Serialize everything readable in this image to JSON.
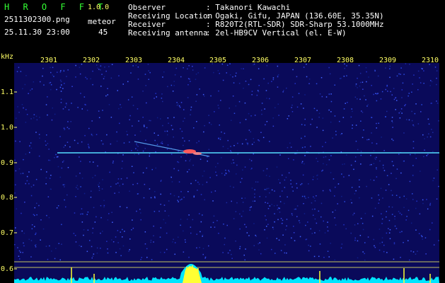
{
  "app": {
    "name": "H R O F F T",
    "version": "1.0.0"
  },
  "file": {
    "name": "2511302300.png",
    "datetime": "25.11.30 23:00"
  },
  "counter": {
    "label": "meteor",
    "value": "45"
  },
  "info": [
    {
      "label": "Observer",
      "value": ": Takanori Kawachi"
    },
    {
      "label": "Receiving Location",
      "value": ": Ogaki, Gifu, JAPAN (136.60E, 35.35N)"
    },
    {
      "label": "Receiver",
      "value": ": R820T2(RTL-SDR) SDR-Sharp 53.1000MHz"
    },
    {
      "label": "Receiving antenna",
      "value": ": 2el-HB9CV Vertical (el. E-W)"
    }
  ],
  "axis": {
    "unit": "kHz",
    "y_ticks": [
      "1.1",
      "1.0",
      "0.9",
      "0.8",
      "0.7",
      "0.6"
    ],
    "x_ticks": [
      "2301",
      "2302",
      "2303",
      "2304",
      "2305",
      "2306",
      "2307",
      "2308",
      "2309",
      "2310"
    ]
  },
  "colors": {
    "background": "#0a0a5a",
    "carrier": "#55e0ff",
    "meteor": "#ff5a5a",
    "spectrum": "#00e5ff",
    "axis_text": "#ffff66"
  }
}
